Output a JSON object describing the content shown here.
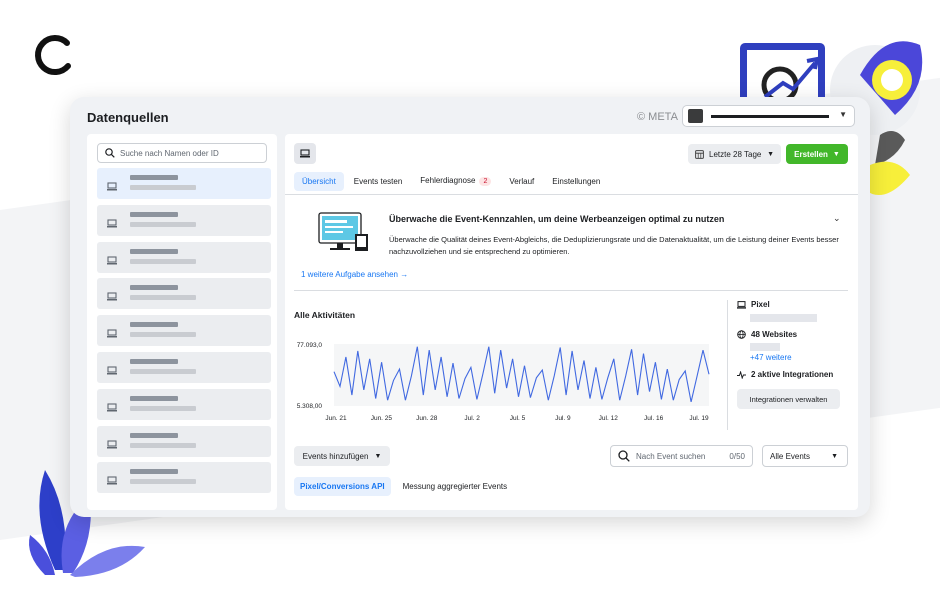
{
  "window": {
    "title": "Datenquellen",
    "meta_label": "© META"
  },
  "sidebar": {
    "search_placeholder": "Suche nach Namen oder ID",
    "items": [
      {
        "active": true
      },
      {
        "active": false
      },
      {
        "active": false
      },
      {
        "active": false
      },
      {
        "active": false
      },
      {
        "active": false
      },
      {
        "active": false
      },
      {
        "active": false
      },
      {
        "active": false
      }
    ]
  },
  "toolbar": {
    "date_range": "Letzte 28 Tage",
    "create_label": "Erstellen"
  },
  "tabs": [
    {
      "label": "Übersicht",
      "active": true
    },
    {
      "label": "Events testen",
      "active": false
    },
    {
      "label": "Fehlerdiagnose",
      "active": false,
      "badge": "2"
    },
    {
      "label": "Verlauf",
      "active": false
    },
    {
      "label": "Einstellungen",
      "active": false
    }
  ],
  "promo": {
    "title": "Überwache die Event-Kennzahlen, um deine Werbeanzeigen optimal zu nutzen",
    "description": "Überwache die Qualität deines Event-Abgleichs, die Deduplizierungsrate und die Datenaktualität, um die Leistung deiner Events besser nachzuvollziehen und sie entsprechend zu optimieren.",
    "link": "1 weitere Aufgabe ansehen →"
  },
  "chart_data": {
    "type": "line",
    "title": "Alle Aktivitäten",
    "y_max_label": "77.093,0",
    "y_min_label": "5.308,00",
    "ylim": [
      5308,
      77093
    ],
    "x_tick_labels": [
      "Jun. 21",
      "Jun. 25",
      "Jun. 28",
      "Jul. 2",
      "Jul. 5",
      "Jul. 9",
      "Jul. 12",
      "Jul. 16",
      "Jul. 19"
    ],
    "series": [
      {
        "color": "#4169e1",
        "values": [
          45000,
          28000,
          62000,
          18000,
          69000,
          24000,
          60000,
          14000,
          56000,
          12000,
          35000,
          48000,
          12000,
          40000,
          74000,
          18000,
          70000,
          24000,
          62000,
          16000,
          55000,
          14000,
          37000,
          50000,
          13000,
          42000,
          74000,
          20000,
          70000,
          26000,
          60000,
          16000,
          52000,
          15000,
          38000,
          47000,
          12000,
          40000,
          73000,
          18000,
          69000,
          24000,
          58000,
          14000,
          50000,
          13000,
          38000,
          60000,
          12000,
          40000,
          71000,
          18000,
          66000,
          22000,
          56000,
          13000,
          48000,
          12000,
          36000,
          46000,
          10000,
          40000,
          70000,
          42000
        ]
      }
    ]
  },
  "stats": {
    "pixel_label": "Pixel",
    "websites_label": "48 Websites",
    "more_websites": "+47 weitere",
    "integrations_label": "2 aktive Integrationen",
    "manage_button": "Integrationen verwalten"
  },
  "events": {
    "add_button": "Events hinzufügen",
    "search_placeholder": "Nach Event suchen",
    "search_count": "0/50",
    "filter_value": "Alle Events",
    "subtabs": [
      {
        "label": "Pixel/Conversions API",
        "active": true
      },
      {
        "label": "Messung aggregierter Events",
        "active": false
      }
    ]
  }
}
